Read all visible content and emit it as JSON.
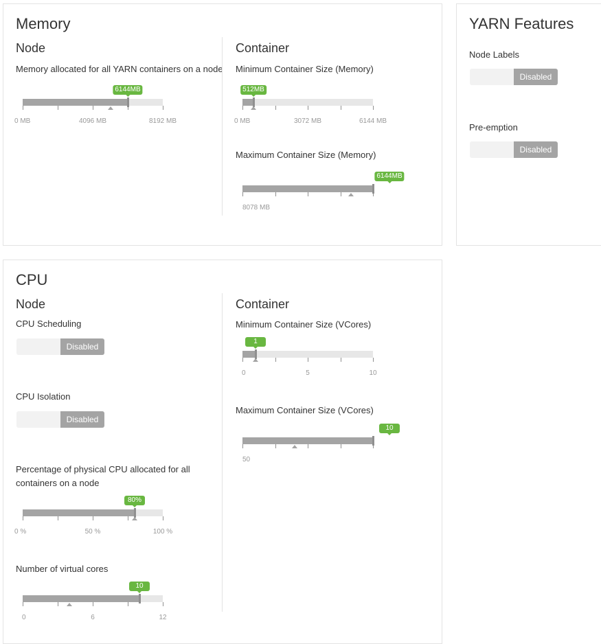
{
  "memory": {
    "title": "Memory",
    "node": {
      "heading": "Node",
      "alloc": {
        "label": "Memory allocated for all YARN containers on a node",
        "tooltip": "6144MB",
        "value_fraction": 0.75,
        "marker_fraction": 0.625,
        "ticks": [
          {
            "text": "0 MB",
            "at": 0
          },
          {
            "text": "4096 MB",
            "at": 0.5
          },
          {
            "text": "8192 MB",
            "at": 1
          }
        ]
      }
    },
    "container": {
      "heading": "Container",
      "min": {
        "label": "Minimum Container Size (Memory)",
        "tooltip": "512MB",
        "value_fraction": 0.083,
        "marker_fraction": 0.083,
        "ticks": [
          {
            "text": "0 MB",
            "at": 0
          },
          {
            "text": "3072 MB",
            "at": 0.5
          },
          {
            "text": "6144 MB",
            "at": 1
          }
        ]
      },
      "max": {
        "label": "Maximum Container Size (Memory)",
        "tooltip": "6144MB",
        "value_fraction": 1.0,
        "marker_fraction": 0.83,
        "ticks": [
          {
            "text": "8078 MB",
            "at": 0
          }
        ]
      }
    }
  },
  "features": {
    "title": "YARN Features",
    "node_labels": {
      "label": "Node Labels",
      "state": "Disabled"
    },
    "preemption": {
      "label": "Pre-emption",
      "state": "Disabled"
    }
  },
  "cpu": {
    "title": "CPU",
    "node": {
      "heading": "Node",
      "scheduling": {
        "label": "CPU Scheduling",
        "state": "Disabled"
      },
      "isolation": {
        "label": "CPU Isolation",
        "state": "Disabled"
      },
      "percent": {
        "label_line1": "Percentage of physical CPU allocated for all",
        "label_line2": "containers on a node",
        "tooltip": "80%",
        "value_fraction": 0.8,
        "marker_fraction": 0.8,
        "ticks": [
          {
            "text": "0 %",
            "at": 0
          },
          {
            "text": "50 %",
            "at": 0.5
          },
          {
            "text": "100 %",
            "at": 1
          }
        ]
      },
      "vcores": {
        "label": "Number of virtual cores",
        "tooltip": "10",
        "value_fraction": 0.833,
        "marker_fraction": 0.333,
        "ticks": [
          {
            "text": "0",
            "at": 0
          },
          {
            "text": "6",
            "at": 0.5
          },
          {
            "text": "12",
            "at": 1
          }
        ]
      }
    },
    "container": {
      "heading": "Container",
      "min": {
        "label": "Minimum Container Size (VCores)",
        "tooltip": "1",
        "value_fraction": 0.1,
        "marker_fraction": 0.1,
        "ticks": [
          {
            "text": "0",
            "at": 0
          },
          {
            "text": "5",
            "at": 0.5
          },
          {
            "text": "10",
            "at": 1
          }
        ]
      },
      "max": {
        "label": "Maximum Container Size (VCores)",
        "tooltip": "10",
        "value_fraction": 1.0,
        "marker_fraction": 0.4,
        "ticks": [
          {
            "text": "50",
            "at": 0
          }
        ]
      }
    }
  }
}
